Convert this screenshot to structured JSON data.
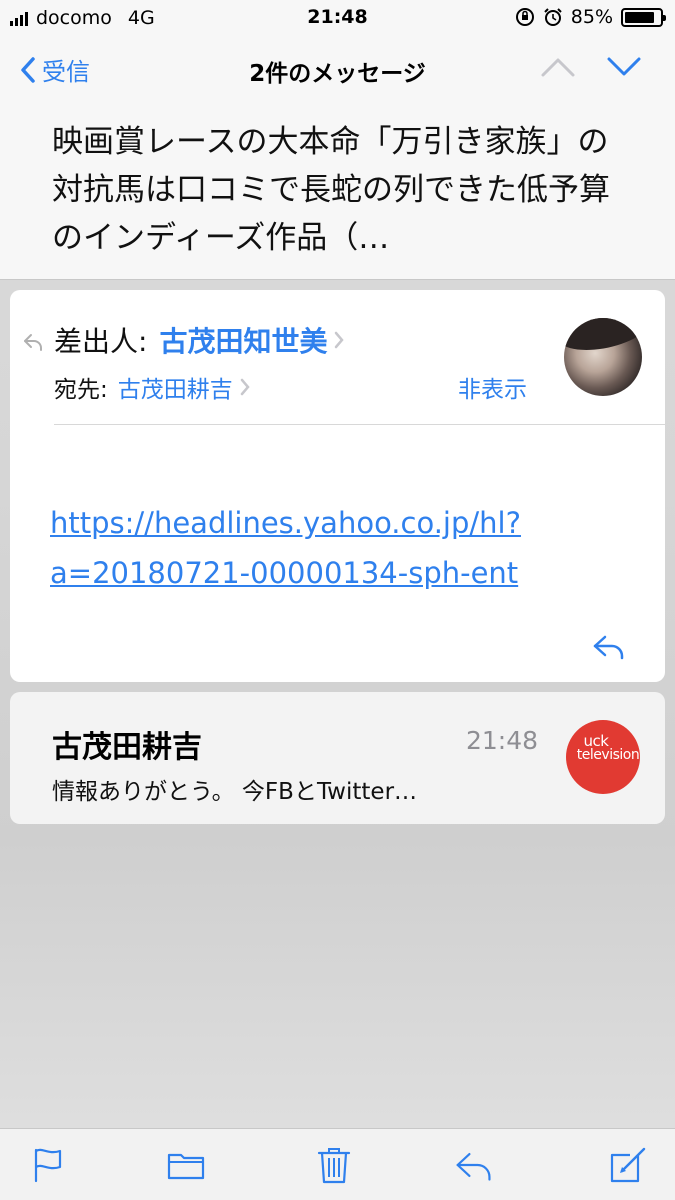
{
  "status_bar": {
    "carrier": "docomo",
    "network": "4G",
    "time": "21:48",
    "battery_percent": "85%",
    "battery_level": 0.85,
    "icons": [
      "signal-icon",
      "rotation-lock-icon",
      "alarm-icon",
      "battery-icon"
    ]
  },
  "nav": {
    "back_label": "受信",
    "title": "2件のメッセージ"
  },
  "subject": "映画賞レースの大本命「万引き家族」の対抗馬は口コミで長蛇の列できた低予算のインディーズ作品（…",
  "mail": {
    "from_label": "差出人:",
    "from_name": "古茂田知世美",
    "to_label": "宛先:",
    "to_name": "古茂田耕吉",
    "hide_label": "非表示",
    "link_line1": "https://headlines.yahoo.co.jp/hl?",
    "link_line2": "a=20180721-00000134-sph-ent"
  },
  "thread_item": {
    "sender": "古茂田耕吉",
    "time": "21:48",
    "preview": "情報ありがとう。 今FBとTwitter…",
    "avatar_text_1": "uck",
    "avatar_text_2": "television"
  },
  "toolbar": {
    "icons": [
      "flag-icon",
      "folder-icon",
      "trash-icon",
      "reply-icon",
      "compose-icon"
    ]
  },
  "colors": {
    "accent": "#2f80ed",
    "secondary_text": "#8e8e93",
    "avatar_red": "#e13a32"
  }
}
